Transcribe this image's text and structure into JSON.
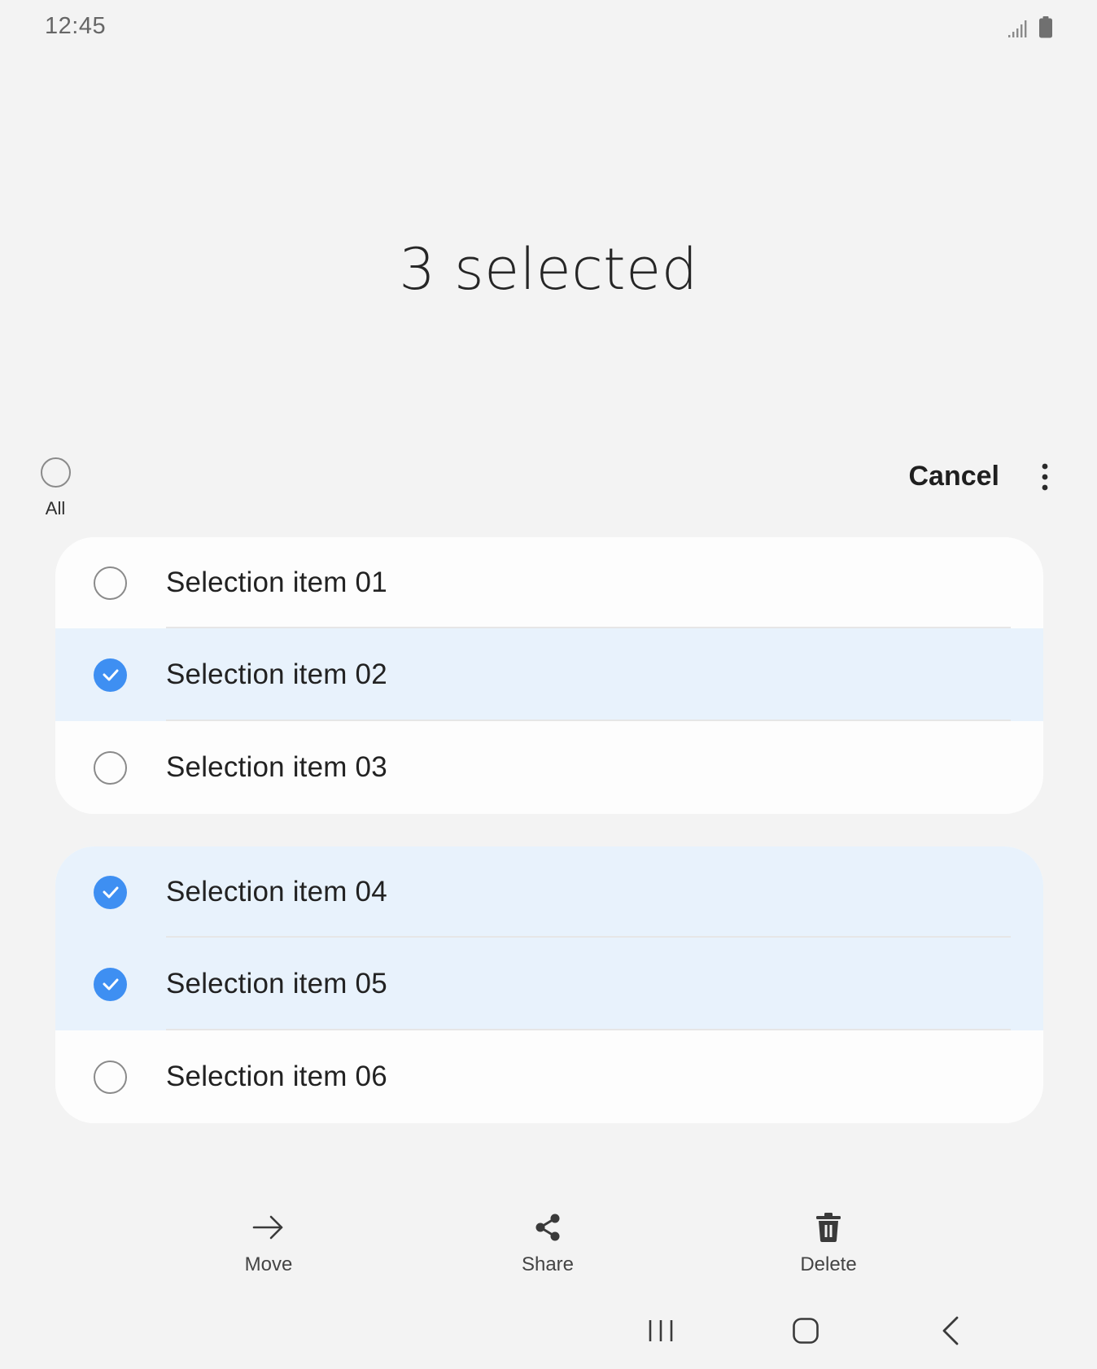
{
  "status_bar": {
    "time": "12:45",
    "icons": [
      "signal-icon",
      "battery-icon"
    ]
  },
  "header": {
    "title": "3 selected"
  },
  "actions": {
    "select_all_label": "All",
    "cancel_label": "Cancel",
    "more_icon": "more-vertical-icon"
  },
  "colors": {
    "accent": "#3e8ff2",
    "selected_row_bg": "#e8f2fc",
    "background": "#f3f3f3",
    "card_bg": "#fdfdfd"
  },
  "lists": [
    {
      "items": [
        {
          "label": "Selection item 01",
          "selected": false
        },
        {
          "label": "Selection item 02",
          "selected": true
        },
        {
          "label": "Selection item 03",
          "selected": false
        }
      ]
    },
    {
      "items": [
        {
          "label": "Selection item 04",
          "selected": true
        },
        {
          "label": "Selection item 05",
          "selected": true
        },
        {
          "label": "Selection item 06",
          "selected": false
        }
      ]
    }
  ],
  "toolbar": {
    "move_label": "Move",
    "share_label": "Share",
    "delete_label": "Delete"
  },
  "navigation": {
    "buttons": [
      "recents-icon",
      "home-icon",
      "back-icon"
    ]
  }
}
